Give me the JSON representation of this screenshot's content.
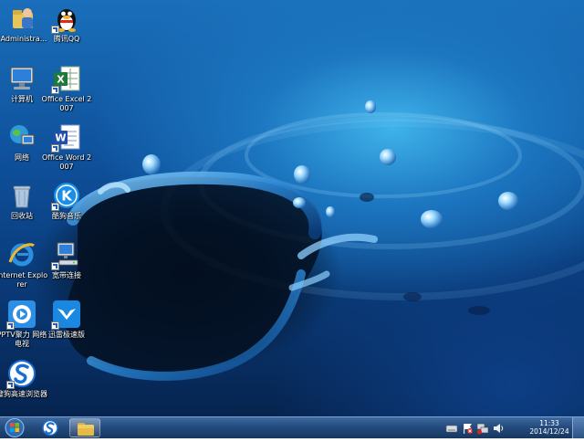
{
  "desktop_icons": [
    {
      "name": "administrator-folder",
      "label": "Administra...",
      "icon": "user-folder-icon"
    },
    {
      "name": "qq",
      "label": "腾讯QQ",
      "icon": "qq-penguin-icon"
    },
    {
      "name": "computer",
      "label": "计算机",
      "icon": "computer-icon"
    },
    {
      "name": "office-excel",
      "label": "Office Excel 2007",
      "icon": "excel-icon"
    },
    {
      "name": "network",
      "label": "网络",
      "icon": "network-globe-icon"
    },
    {
      "name": "office-word",
      "label": "Office Word 2007",
      "icon": "word-icon"
    },
    {
      "name": "recycle-bin",
      "label": "回收站",
      "icon": "recycle-bin-icon"
    },
    {
      "name": "kugou-music",
      "label": "酷狗音乐",
      "icon": "kugou-icon"
    },
    {
      "name": "internet-explorer",
      "label": "Internet Explorer",
      "icon": "ie-icon"
    },
    {
      "name": "broadband",
      "label": "宽带连接",
      "icon": "broadband-icon"
    },
    {
      "name": "pptv",
      "label": "PPTV聚力 网络电视",
      "icon": "pptv-icon"
    },
    {
      "name": "xunlei",
      "label": "迅雷极速版",
      "icon": "xunlei-icon"
    },
    {
      "name": "sogou-browser",
      "label": "搜狗高速浏览器",
      "icon": "sogou-icon"
    }
  ],
  "taskbar": {
    "pinned": [
      {
        "name": "sogou-browser",
        "icon": "sogou-icon"
      },
      {
        "name": "explorer",
        "icon": "folder-icon"
      }
    ],
    "tray_icons": [
      "keyboard-icon",
      "flag-icon",
      "network-icon",
      "volume-icon"
    ],
    "clock_time": "11:33",
    "clock_date": "2014/12/24"
  }
}
